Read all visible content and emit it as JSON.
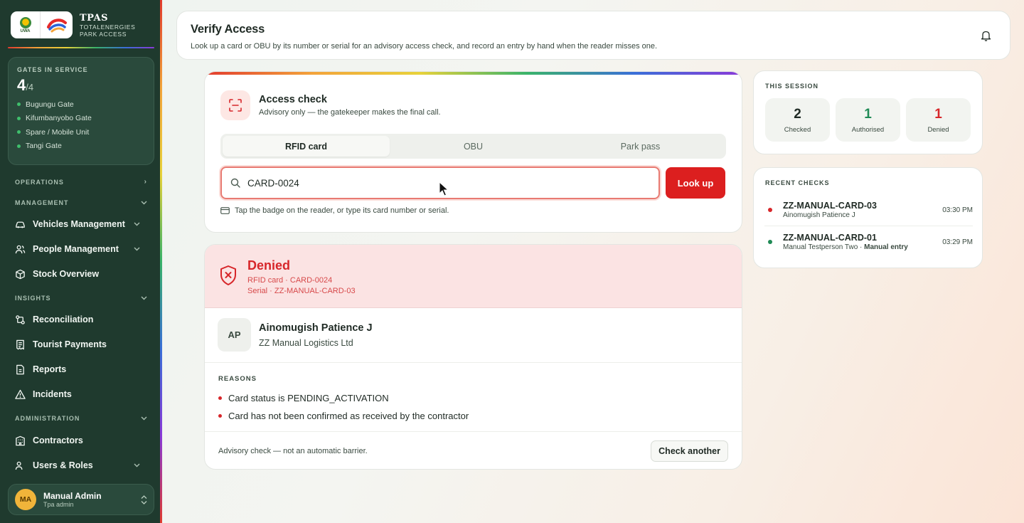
{
  "brand": {
    "title": "TPAS",
    "subtitle_line1": "TOTALENERGIES",
    "subtitle_line2": "PARK ACCESS",
    "uwa_logo_text": "UWA"
  },
  "gates": {
    "label": "GATES IN SERVICE",
    "in_service": "4",
    "total": "/4",
    "list": [
      "Bugungu Gate",
      "Kifumbanyobo Gate",
      "Spare / Mobile Unit",
      "Tangi Gate"
    ]
  },
  "nav": {
    "operations": "OPERATIONS",
    "management": "MANAGEMENT",
    "vehicles": "Vehicles Management",
    "people": "People Management",
    "stock": "Stock Overview",
    "insights": "INSIGHTS",
    "reconciliation": "Reconciliation",
    "tourist_payments": "Tourist Payments",
    "reports": "Reports",
    "incidents": "Incidents",
    "administration": "ADMINISTRATION",
    "contractors": "Contractors",
    "users_roles": "Users & Roles"
  },
  "user": {
    "initials": "MA",
    "name": "Manual Admin",
    "role": "Tpa admin"
  },
  "header": {
    "title": "Verify Access",
    "description": "Look up a card or OBU by its number or serial for an advisory access check, and record an entry by hand when the reader misses one."
  },
  "access_check": {
    "title": "Access check",
    "subtitle": "Advisory only — the gatekeeper makes the final call.",
    "tabs": [
      "RFID card",
      "OBU",
      "Park pass"
    ],
    "active_tab": "RFID card",
    "search_value": "CARD-0024",
    "lookup_label": "Look up",
    "hint": "Tap the badge on the reader, or type its card number or serial."
  },
  "result": {
    "status": "Denied",
    "card_line": "RFID card · CARD-0024",
    "serial_line": "Serial · ZZ-MANUAL-CARD-03",
    "person_initials": "AP",
    "person_name": "Ainomugish Patience J",
    "person_org": "ZZ Manual Logistics Ltd",
    "reasons_label": "REASONS",
    "reasons": [
      "Card status is PENDING_ACTIVATION",
      "Card has not been confirmed as received by the contractor"
    ],
    "footer_note": "Advisory check — not an automatic barrier.",
    "check_another_label": "Check another"
  },
  "session": {
    "label": "THIS SESSION",
    "stats": [
      {
        "value": "2",
        "label": "Checked",
        "color": "#1f2a24"
      },
      {
        "value": "1",
        "label": "Authorised",
        "color": "#1f8a55"
      },
      {
        "value": "1",
        "label": "Denied",
        "color": "#d7262a"
      }
    ]
  },
  "recent": {
    "label": "RECENT CHECKS",
    "items": [
      {
        "id": "ZZ-MANUAL-CARD-03",
        "who": "Ainomugish Patience J",
        "extra": "",
        "time": "03:30 PM",
        "status_color": "#d7262a"
      },
      {
        "id": "ZZ-MANUAL-CARD-01",
        "who": "Manual Testperson Two · ",
        "extra": "Manual entry",
        "time": "03:29 PM",
        "status_color": "#1f8a55"
      }
    ]
  },
  "colors": {
    "accent_red": "#dc1f1f",
    "sidebar_bg": "#1f3a2e",
    "authorised_green": "#1f8a55"
  }
}
